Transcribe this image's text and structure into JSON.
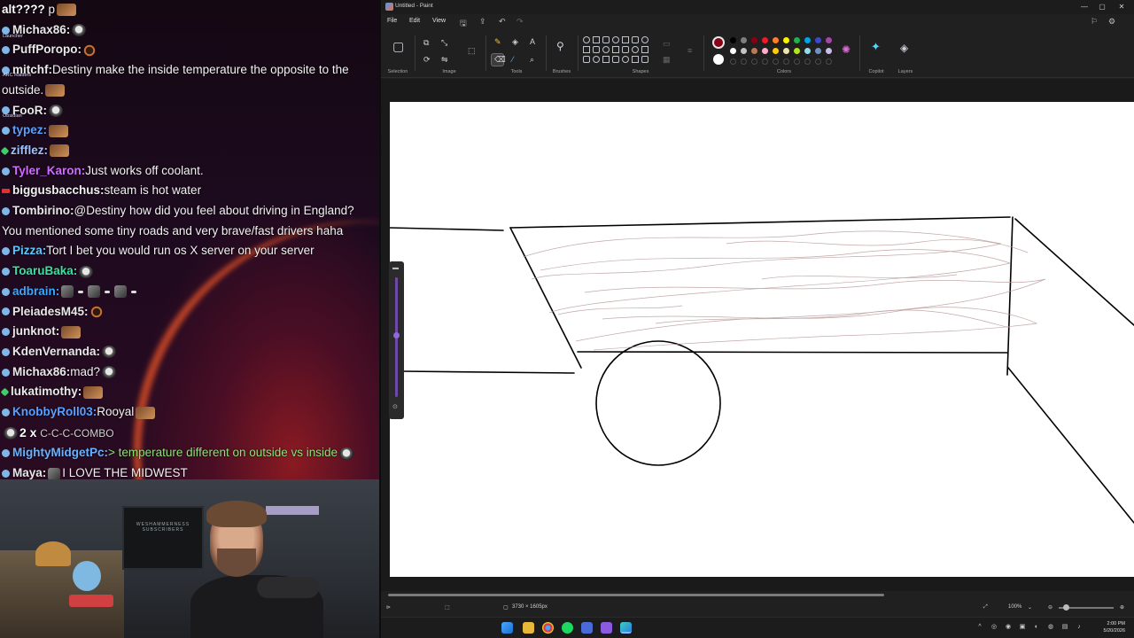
{
  "chat": {
    "lines": [
      {
        "name": "alt???? ",
        "name_color": "#ffffff",
        "text": "p",
        "emotes": [
          "pic"
        ],
        "badge": ""
      },
      {
        "name": "Michax86:",
        "name_color": "#e8e8e8",
        "text": "",
        "emotes": [
          "face"
        ],
        "badge": "blue"
      },
      {
        "name": "PuffPoropo:",
        "name_color": "#e8e8e8",
        "text": "",
        "emotes": [
          "ring"
        ],
        "badge": "blue"
      },
      {
        "name": "mitchf:",
        "name_color": "#e8e8e8",
        "text": "Destiny make the inside temperature the opposite to the outside.",
        "emotes": [
          "pic"
        ],
        "badge": "blue"
      },
      {
        "name": "FooR:",
        "name_color": "#e8e8e8",
        "text": "",
        "emotes": [
          "face"
        ],
        "badge": "blue"
      },
      {
        "name": "typez:",
        "name_color": "#5aa0ff",
        "text": "",
        "emotes": [
          "pic"
        ],
        "badge": "blue"
      },
      {
        "name": "zifflez:",
        "name_color": "#9fc3ff",
        "text": "",
        "emotes": [
          "pic"
        ],
        "badge": "green"
      },
      {
        "name": "Tyler_Karon:",
        "name_color": "#d06cff",
        "text": "Just works off coolant.",
        "emotes": [],
        "badge": "blue"
      },
      {
        "name": "biggusbacchus:",
        "name_color": "#f0f0f0",
        "text": "steam is hot water",
        "emotes": [],
        "badge": "red"
      },
      {
        "name": "Tombirino:",
        "name_color": "#e8e8e8",
        "text": "@Destiny how did you feel about driving in England? You mentioned some tiny roads and very brave/fast drivers haha",
        "emotes": [],
        "badge": "blue"
      },
      {
        "name": "Pizza:",
        "name_color": "#5ac8ff",
        "text": "Tort I bet you would run os X server on your server",
        "emotes": [],
        "badge": "blue"
      },
      {
        "name": "ToaruBaka:",
        "name_color": "#3ae0a0",
        "text": "",
        "emotes": [
          "face"
        ],
        "badge": "blue"
      },
      {
        "name": "adbrain:",
        "name_color": "#3aa8ff",
        "text": "",
        "emotes": [
          "grey",
          "grey",
          "grey"
        ],
        "badge": "blue"
      },
      {
        "name": "PleiadesM45:",
        "name_color": "#e8e8e8",
        "text": "",
        "emotes": [
          "ring"
        ],
        "badge": "blue"
      },
      {
        "name": "junknot:",
        "name_color": "#e8e8e8",
        "text": "",
        "emotes": [
          "pic"
        ],
        "badge": "blue"
      },
      {
        "name": "KdenVernanda:",
        "name_color": "#e8e8e8",
        "text": "",
        "emotes": [
          "face"
        ],
        "badge": "blue"
      },
      {
        "name": "Michax86:",
        "name_color": "#e8e8e8",
        "text": "mad?",
        "emotes": [
          "face"
        ],
        "badge": "blue"
      },
      {
        "name": "lukatimothy:",
        "name_color": "#e8e8e8",
        "text": "",
        "emotes": [
          "pic"
        ],
        "badge": "green"
      },
      {
        "name": "KnobbyRoll03:",
        "name_color": "#5aa0ff",
        "text": "Rooyal",
        "emotes": [
          "pic"
        ],
        "badge": "blue"
      },
      {
        "name": "",
        "name_color": "#ffffff",
        "text": "",
        "emotes": [],
        "badge": "",
        "combo": true
      },
      {
        "name": "MightyMidgetPc:",
        "name_color": "#6ab0ff",
        "text": "> temperature different on outside vs inside",
        "text_color": "#8fe07a",
        "emotes": [
          "face"
        ],
        "badge": "blue"
      },
      {
        "name": "Maya:",
        "name_color": "#e8e8e8",
        "text": "I LOVE THE MIDWEST",
        "emotes": [
          "grey"
        ],
        "badge": "blue",
        "emote_first": true
      }
    ],
    "combo": {
      "count": "2 x",
      "label": "C-C-C-COMBO"
    }
  },
  "dock": {
    "items": [
      "Launcher",
      "ARC Raiders",
      "Obsidian"
    ]
  },
  "webcam": {
    "frame_text": "WESHAMMERNESS SUBSCRIBERS"
  },
  "paint": {
    "title": "Untitled - Paint",
    "menu": [
      "File",
      "Edit",
      "View"
    ],
    "groups": {
      "selection": "Selection",
      "image": "Image",
      "tools": "Tools",
      "brushes": "Brushes",
      "shapes": "Shapes",
      "colors": "Colors",
      "copilot": "Copilot",
      "layers": "Layers"
    },
    "colors": {
      "primary": "#880015",
      "secondary": "#ffffff",
      "palette_row1": [
        "#000000",
        "#7f7f7f",
        "#880015",
        "#ed1c24",
        "#ff7f27",
        "#fff200",
        "#22b14c",
        "#00a2e8",
        "#3f48cc",
        "#a349a4"
      ],
      "palette_row2": [
        "#ffffff",
        "#c3c3c3",
        "#b97a57",
        "#ffaec9",
        "#ffc90e",
        "#efe4b0",
        "#b5e61d",
        "#99d9ea",
        "#7092be",
        "#c8bfe7"
      ]
    },
    "status": {
      "dimensions": "3730 × 1605px",
      "zoom": "100%"
    }
  },
  "taskbar": {
    "time": "2:00 PM",
    "date": "5/20/2026"
  }
}
